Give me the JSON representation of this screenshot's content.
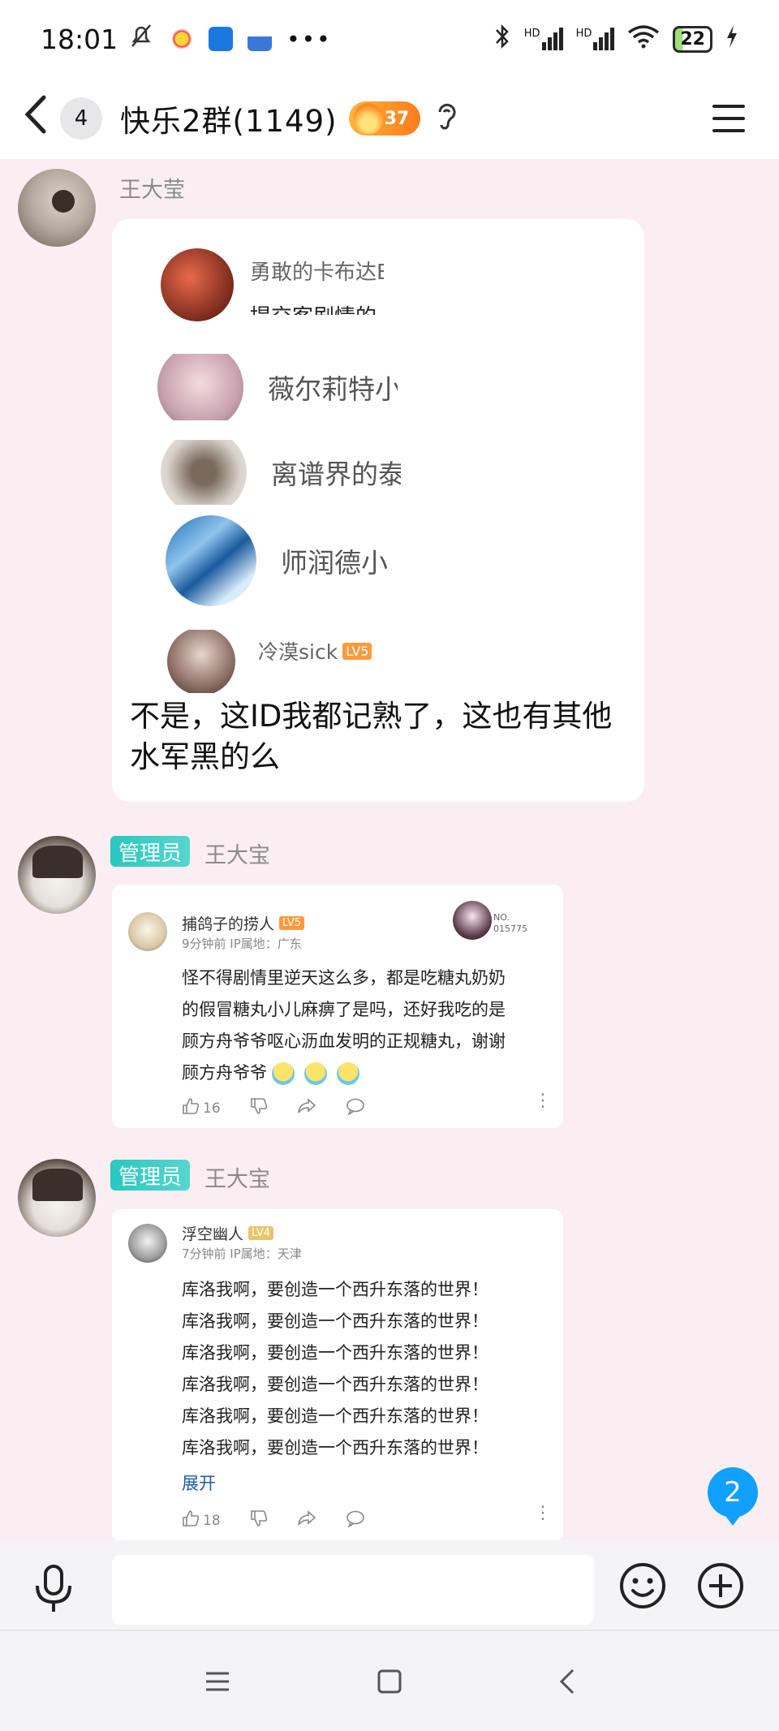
{
  "status_bar": {
    "time": "18:01",
    "signal_1": "HD",
    "signal_2": "HD",
    "battery": "22"
  },
  "header": {
    "back_label": "‹",
    "unread_count": "4",
    "group_title": "快乐2群(1149)",
    "fire_level": "37"
  },
  "messages": [
    {
      "sender": "王大莹",
      "embedded_list": [
        {
          "name": "勇敢的卡布达E",
          "sub": "提交客剧情的"
        },
        {
          "name": "薇尔莉特小"
        },
        {
          "name": "离谱界的泰"
        },
        {
          "name": "师润德小"
        },
        {
          "name": "冷漠sick",
          "badge": "LV5"
        }
      ],
      "text": "不是，这ID我都记熟了，这也有其他水军黑的么"
    },
    {
      "admin_tag": "管理员",
      "sender": "王大宝",
      "comment": {
        "user": "捕鸽子的捞人",
        "badge": "LV5",
        "no_label": "NO.",
        "no_value": "015775",
        "meta": "9分钟前 IP属地：广东",
        "lines": [
          "怪不得剧情里逆天这么多，都是吃糖丸奶奶",
          "的假冒糖丸小儿麻痹了是吗，还好我吃的是",
          "顾方舟爷爷呕心沥血发明的正规糖丸，谢谢",
          "顾方舟爷爷"
        ],
        "likes": "16"
      }
    },
    {
      "admin_tag": "管理员",
      "sender": "王大宝",
      "comment": {
        "user": "浮空幽人",
        "badge": "LV4",
        "meta": "7分钟前 IP属地：天津",
        "lines": [
          "库洛我啊，要创造一个西升东落的世界！",
          "库洛我啊，要创造一个西升东落的世界！",
          "库洛我啊，要创造一个西升东落的世界！",
          "库洛我啊，要创造一个西升东落的世界！",
          "库洛我啊，要创造一个西升东落的世界！",
          "库洛我啊，要创造一个西升东落的世界！"
        ],
        "expand": "展开",
        "likes": "18"
      }
    }
  ],
  "new_message_count": "2",
  "colors": {
    "chat_bg": "#fbeef2",
    "admin_tag": "#29c7c0",
    "unread_bubble": "#12a0ff"
  }
}
